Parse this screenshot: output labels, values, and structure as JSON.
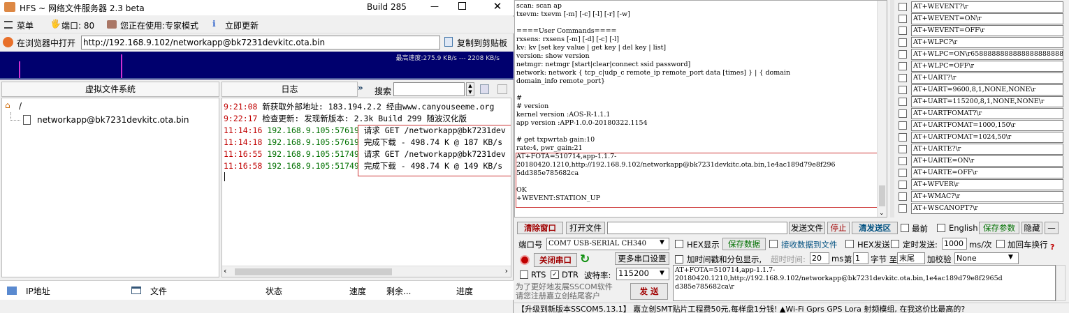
{
  "hfs": {
    "title": "HFS ~ 网络文件服务器 2.3 beta",
    "build": "Build 285",
    "menu": {
      "menu": "菜单",
      "port": "端口: 80",
      "mode": "您正在使用:专家模式",
      "update": "立即更新"
    },
    "open_in_browser": "在浏览器中打开",
    "url": "http://192.168.9.102/networkapp@bk7231devkitc.ota.bin",
    "copy_clipboard": "复制到剪贴板",
    "graph_label": "最高速度:275.9 KB/s --- 2208 KB/s",
    "vfs_header": "虚拟文件系统",
    "log_header": "日志",
    "search_label": "搜索",
    "vfs_root": "/",
    "vfs_file": "networkapp@bk7231devkitc.ota.bin",
    "log": [
      {
        "time": "9:21:08",
        "text": "新获取外部地址: 183.194.2.2 经由www.canyouseeme.org"
      },
      {
        "time": "9:22:17",
        "text": "检查更新: 发现新版本: 2.3k Build 299 随波汉化版"
      },
      {
        "time": "11:14:16",
        "addr": "192.168.9.105:57619",
        "text": "请求 GET /networkapp@bk7231dev"
      },
      {
        "time": "11:14:18",
        "addr": "192.168.9.105:57619",
        "text": "完成下载 - 498.74 K @ 187 KB/s"
      },
      {
        "time": "11:16:55",
        "addr": "192.168.9.105:51749",
        "text": "请求 GET /networkapp@bk7231dev"
      },
      {
        "time": "11:16:58",
        "addr": "192.168.9.105:51749",
        "text": "完成下载 - 498.74 K @ 149 KB/s"
      }
    ],
    "columns": {
      "ip": "IP地址",
      "file": "文件",
      "status": "状态",
      "speed": "速度",
      "remaining": "剩余...",
      "progress": "进度"
    }
  },
  "sscom": {
    "terminal_lines": [
      "scan: scan ap",
      "txevm: txevm [-m] [-c] [-l] [-r] [-w]",
      "",
      "====User Commands====",
      "rxsens: rxsens [-m] [-d] [-c] [-l]",
      "kv: kv [set key value | get key | del key | list]",
      "version: show version",
      "netmgr: netmgr [start|clear|connect ssid password]",
      "network: network { tcp_c|udp_c remote_ip remote_port data [times] } | { domain",
      "domain_info remote_port}",
      "",
      "#",
      "# version",
      "kernel version :AOS-R-1.1.1",
      "app version :APP-1.0.0-20180322.1154",
      "",
      "# get txpwrtab gain:10",
      "rate:4, pwr_gain:21",
      "AT+FOTA=510714,app-1.1.7-",
      "20180420.1210,http://192.168.9.102/networkapp@bk7231devkitc.ota.bin,1e4ac189d79e8f296",
      "5dd385e785682ca",
      "",
      "OK",
      "+WEVENT:STATION_UP"
    ],
    "commands": [
      "AT+WEVENT?\\r",
      "AT+WEVENT=ON\\r",
      "AT+WEVENT=OFF\\r",
      "AT+WLPC?\\r",
      "AT+WLPC=ON\\r658888888888888888888888",
      "AT+WLPC=OFF\\r",
      "AT+UART?\\r",
      "AT+UART=9600,8,1,NONE,NONE\\r",
      "AT+UART=115200,8,1,NONE,NONE\\r",
      "AT+UARTFOMAT?\\r",
      "AT+UARTFOMAT=1000,150\\r",
      "AT+UARTFOMAT=1024,50\\r",
      "AT+UARTE?\\r",
      "AT+UARTE=ON\\r",
      "AT+UARTE=OFF\\r",
      "AT+WFVER\\r",
      "AT+WMAC?\\r",
      "AT+WSCANOPT?\\r"
    ],
    "toolbar": {
      "clear": "清除窗口",
      "open_file": "打开文件",
      "send_file": "发送文件",
      "stop": "停止",
      "clear_send": "清发送区",
      "topmost": "最前",
      "english": "English",
      "save_params": "保存参数",
      "hide": "隐藏",
      "minus": "—"
    },
    "port_label": "端口号",
    "port_value": "COM7 USB-SERIAL CH340",
    "hex_display": "HEX显示",
    "save_data": "保存数据",
    "recv_to_file": "接收数据到文件",
    "hex_send": "HEX发送",
    "timed_send": "定时发送:",
    "interval": "1000",
    "interval_unit": "ms/次",
    "add_crlf": "加回车换行",
    "close_port": "关闭串口",
    "more_settings": "更多串口设置",
    "timestamp": "加时间戳和分包显示,",
    "timeout_label": "超时时间:",
    "timeout_value": "20",
    "ms": "ms",
    "nth": "第",
    "byte_from": "1",
    "byte_to_label": "字节 至",
    "byte_to": "末尾",
    "checksum_label": "加校验",
    "checksum_value": "None",
    "rts": "RTS",
    "dtr": "DTR",
    "baud_label": "波特率:",
    "baud_value": "115200",
    "send_text": "AT+FOTA=510714,app-1.1.7-\n20180420.1210,http://192.168.9.102/networkapp@bk7231devkitc.ota.bin,1e4ac189d79e8f2965d\nd385e785682ca\\r",
    "promo": "为了更好地发展SSCOM软件\n请您注册嘉立创结尾客户",
    "send": "发 送",
    "status": "【升级到新版本SSCOM5.13.1】    嘉立创SMT贴片工程费50元,每样盘1分钱! ▲Wi-Fi Gprs GPS Lora 射频模组, 在我这价比最高的?"
  }
}
